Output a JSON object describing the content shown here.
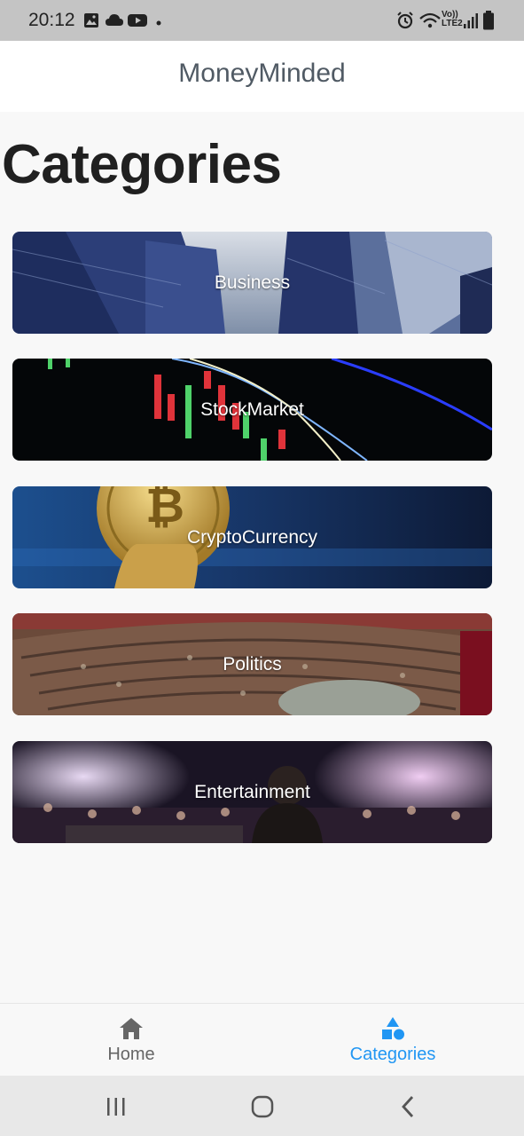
{
  "status_bar": {
    "time": "20:12",
    "left_icons": [
      "image-icon",
      "cloud-icon",
      "youtube-icon",
      "dot-icon"
    ],
    "right_icons": [
      "alarm-icon",
      "wifi-icon",
      "volte-icon",
      "signal-icon",
      "battery-icon"
    ],
    "volte_text": "Vo)) LTE2"
  },
  "app_bar": {
    "title": "MoneyMinded"
  },
  "page": {
    "title": "Categories"
  },
  "categories": [
    {
      "label": "Business",
      "image": "business-skyscrapers-image"
    },
    {
      "label": "StockMarket",
      "image": "stock-chart-image"
    },
    {
      "label": "CryptoCurrency",
      "image": "bitcoin-coin-image"
    },
    {
      "label": "Politics",
      "image": "parliament-chamber-image"
    },
    {
      "label": "Entertainment",
      "image": "concert-crowd-image"
    }
  ],
  "bottom_nav": {
    "items": [
      {
        "label": "Home",
        "icon": "home-icon",
        "active": false
      },
      {
        "label": "Categories",
        "icon": "categories-icon",
        "active": true
      }
    ],
    "active_color": "#2196f3",
    "inactive_color": "#666666"
  },
  "system_nav": [
    "recent-apps-icon",
    "home-circle-icon",
    "back-icon"
  ]
}
